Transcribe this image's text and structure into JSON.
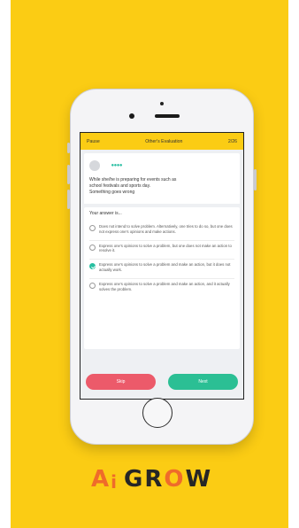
{
  "app": {
    "brand_parts": {
      "a": "A",
      "i": "i",
      "g_r": "GR",
      "o": "O",
      "w": "W"
    }
  },
  "header": {
    "left": "Pause",
    "title": "Other's Evaluation",
    "progress": "2/26"
  },
  "scenario": {
    "speaker_name": "●●●●",
    "text_lines": [
      "While she/he is preparing for events such as",
      "school festivals and sports day.",
      "Something goes wrong"
    ]
  },
  "answers": {
    "title": "Your answer is...",
    "options": [
      {
        "label": "Does not intend to solve problem. Alternatively, one tries to do so, but one does not express one's opinions and make actions.",
        "selected": false
      },
      {
        "label": "Express one's opinions to solve a problem, but one does not make an action to resolve it.",
        "selected": false
      },
      {
        "label": "Express one's opinions to solve a problem and make an action, but it does not actually work.",
        "selected": true
      },
      {
        "label": "Express one's opinions to solve a problem and make an action, and it actually solves the problem.",
        "selected": false
      }
    ]
  },
  "footer": {
    "skip_label": "Skip",
    "next_label": "Next"
  },
  "colors": {
    "background": "#fbcc14",
    "accent": "#2bbf94",
    "skip": "#ec5a6a",
    "brand_orange": "#ef6b2a"
  }
}
